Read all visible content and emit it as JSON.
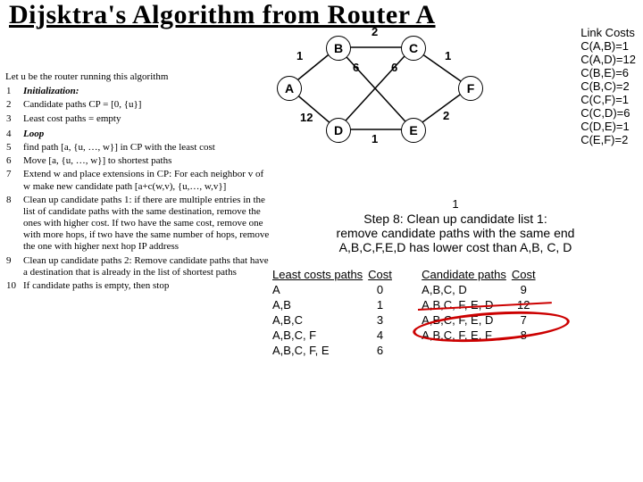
{
  "title": "Dijsktra's Algorithm from Router A",
  "algo": {
    "lead": "Let u be the router running this algorithm",
    "lines": [
      {
        "n": "1",
        "t": "Initialization:",
        "style": "it"
      },
      {
        "n": "2",
        "t": "Candidate paths CP = [0, {u}]"
      },
      {
        "n": "3",
        "t": "Least cost paths = empty"
      },
      {
        "n": "",
        "t": ""
      },
      {
        "n": "4",
        "t": "Loop",
        "style": "it"
      },
      {
        "n": "5",
        "t": "find path [a, {u, …, w}] in CP with the least cost"
      },
      {
        "n": "6",
        "t": "Move [a, {u, …, w}] to shortest paths"
      },
      {
        "n": "7",
        "t": "Extend w and place extensions in CP: For each neighbor v of w make new candidate path [a+c(w,v), {u,…, w,v}]"
      },
      {
        "n": "8",
        "t": "Clean up candidate paths 1: if there are multiple entries in the list of candidate paths with the same destination, remove the ones with higher cost. If two have the same cost, remove one with more hops, if two have the same number of hops, remove the one with higher next hop IP address"
      },
      {
        "n": "9",
        "t": "Clean up candidate paths 2: Remove candidate paths that have a destination that is already in the list of shortest paths"
      },
      {
        "n": "10",
        "t": "If candidate paths is empty, then stop"
      }
    ]
  },
  "graph": {
    "nodes": {
      "A": "A",
      "B": "B",
      "C": "C",
      "D": "D",
      "E": "E",
      "F": "F"
    },
    "weights": {
      "AB": "1",
      "BC": "2",
      "CF": "1",
      "BE": "6",
      "CE": "6",
      "AD": "12",
      "DE": "1",
      "EF": "2"
    }
  },
  "linkcosts": {
    "hdr": "Link Costs",
    "rows": [
      "C(A,B)=1",
      "C(A,D)=12",
      "C(B,E)=6",
      "C(B,C)=2",
      "C(C,F)=1",
      "C(C,D)=6",
      "C(D,E)=1",
      "C(E,F)=2"
    ]
  },
  "step": {
    "num": "1",
    "l1": "Step 8: Clean up candidate list 1:",
    "l2": "remove candidate paths with the same end",
    "l3": "A,B,C,F,E,D has lower cost than A,B, C, D"
  },
  "tables": {
    "least": {
      "h1": "Least costs paths",
      "h2": "Cost",
      "rows": [
        {
          "p": "A",
          "c": "0"
        },
        {
          "p": "A,B",
          "c": "1"
        },
        {
          "p": "A,B,C",
          "c": "3"
        },
        {
          "p": "A,B,C, F",
          "c": "4"
        },
        {
          "p": "A,B,C, F, E",
          "c": "6"
        }
      ]
    },
    "cand": {
      "h1": "Candidate paths",
      "h2": "Cost",
      "rows": [
        {
          "p": "A,B,C, D",
          "c": "9"
        },
        {
          "p": "A,B,C, F, E, D",
          "c": "12"
        },
        {
          "p": "A,B,C, F, E, D",
          "c": "7"
        },
        {
          "p": "A,B,C, F, E, F",
          "c": "8"
        }
      ]
    }
  }
}
